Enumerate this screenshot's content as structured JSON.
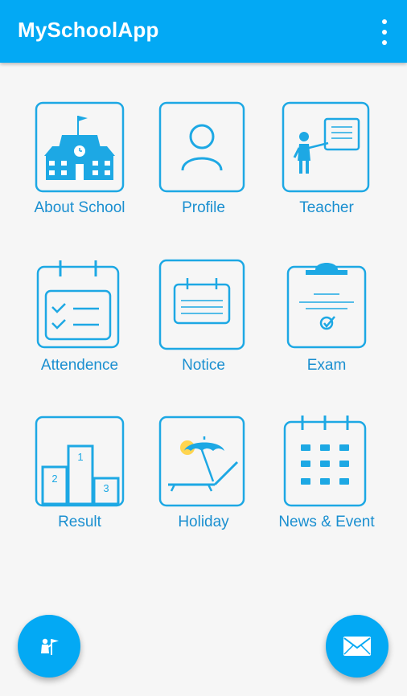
{
  "appbar": {
    "title": "MySchoolApp"
  },
  "tiles": [
    {
      "label": "About School",
      "icon": "school-building-icon"
    },
    {
      "label": "Profile",
      "icon": "user-profile-icon"
    },
    {
      "label": "Teacher",
      "icon": "teacher-board-icon"
    },
    {
      "label": "Attendence",
      "icon": "attendance-calendar-icon"
    },
    {
      "label": "Notice",
      "icon": "notice-board-icon"
    },
    {
      "label": "Exam",
      "icon": "exam-clipboard-icon"
    },
    {
      "label": "Result",
      "icon": "podium-result-icon"
    },
    {
      "label": "Holiday",
      "icon": "beach-holiday-icon"
    },
    {
      "label": "News & Event",
      "icon": "event-calendar-icon"
    }
  ],
  "fabs": {
    "left_icon": "teacher-flag-icon",
    "right_icon": "mail-icon"
  },
  "colors": {
    "primary": "#03a9f4",
    "icon_stroke": "#1da8e4",
    "label": "#1a8fd0",
    "background": "#f6f6f6",
    "sun": "#ffd54f"
  }
}
